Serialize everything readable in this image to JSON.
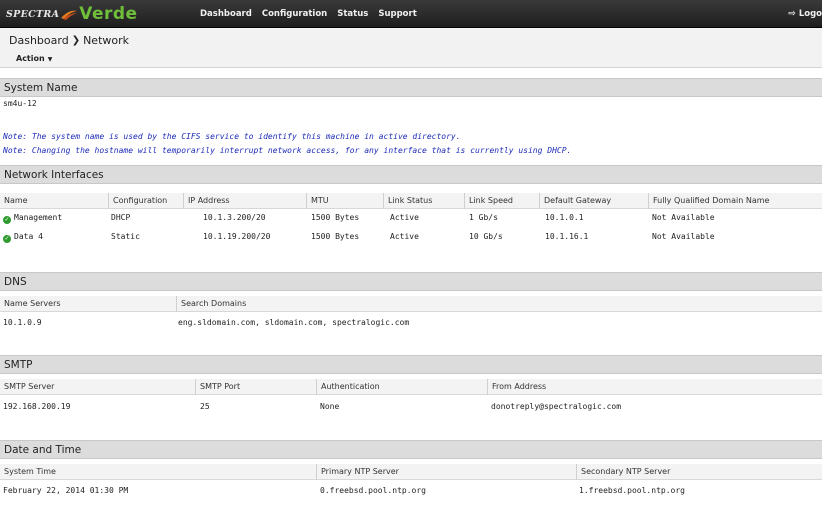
{
  "header": {
    "logo": {
      "spectra": "SPECTRA",
      "verde": "Verde"
    },
    "nav": [
      "Dashboard",
      "Configuration",
      "Status",
      "Support"
    ],
    "logout": "Logo"
  },
  "breadcrumb": {
    "root": "Dashboard",
    "current": "Network"
  },
  "action_label": "Action",
  "system_name": {
    "title": "System Name",
    "value": "sm4u-12",
    "notes": [
      "Note: The system name is used by the CIFS service to identify this machine in active directory.",
      "Note: Changing the hostname will temporarily interrupt network access, for any interface that is currently using DHCP."
    ]
  },
  "network_interfaces": {
    "title": "Network Interfaces",
    "columns": [
      "Name",
      "Configuration",
      "IP Address",
      "MTU",
      "Link Status",
      "Link Speed",
      "Default Gateway",
      "Fully Qualified Domain Name"
    ],
    "rows": [
      [
        "Management",
        "DHCP",
        "10.1.3.200/20",
        "1500 Bytes",
        "Active",
        "1 Gb/s",
        "10.1.0.1",
        "Not Available"
      ],
      [
        "Data 4",
        "Static",
        "10.1.19.200/20",
        "1500 Bytes",
        "Active",
        "10 Gb/s",
        "10.1.16.1",
        "Not Available"
      ]
    ]
  },
  "dns": {
    "title": "DNS",
    "columns": [
      "Name Servers",
      "Search Domains"
    ],
    "row": [
      "10.1.0.9",
      "eng.sldomain.com, sldomain.com, spectralogic.com"
    ]
  },
  "smtp": {
    "title": "SMTP",
    "columns": [
      "SMTP Server",
      "SMTP Port",
      "Authentication",
      "From Address"
    ],
    "row": [
      "192.168.200.19",
      "25",
      "None",
      "donotreply@spectralogic.com"
    ]
  },
  "datetime": {
    "title": "Date and Time",
    "columns": [
      "System Time",
      "Primary NTP Server",
      "Secondary NTP Server"
    ],
    "row": [
      "February 22, 2014 01:30 PM",
      "0.freebsd.pool.ntp.org",
      "1.freebsd.pool.ntp.org"
    ]
  },
  "colors": {
    "brand_green": "#6fbf3a",
    "topbar": "#2a2a2a",
    "note_blue": "#1d2bb8",
    "status_green": "#2e9b2e"
  }
}
